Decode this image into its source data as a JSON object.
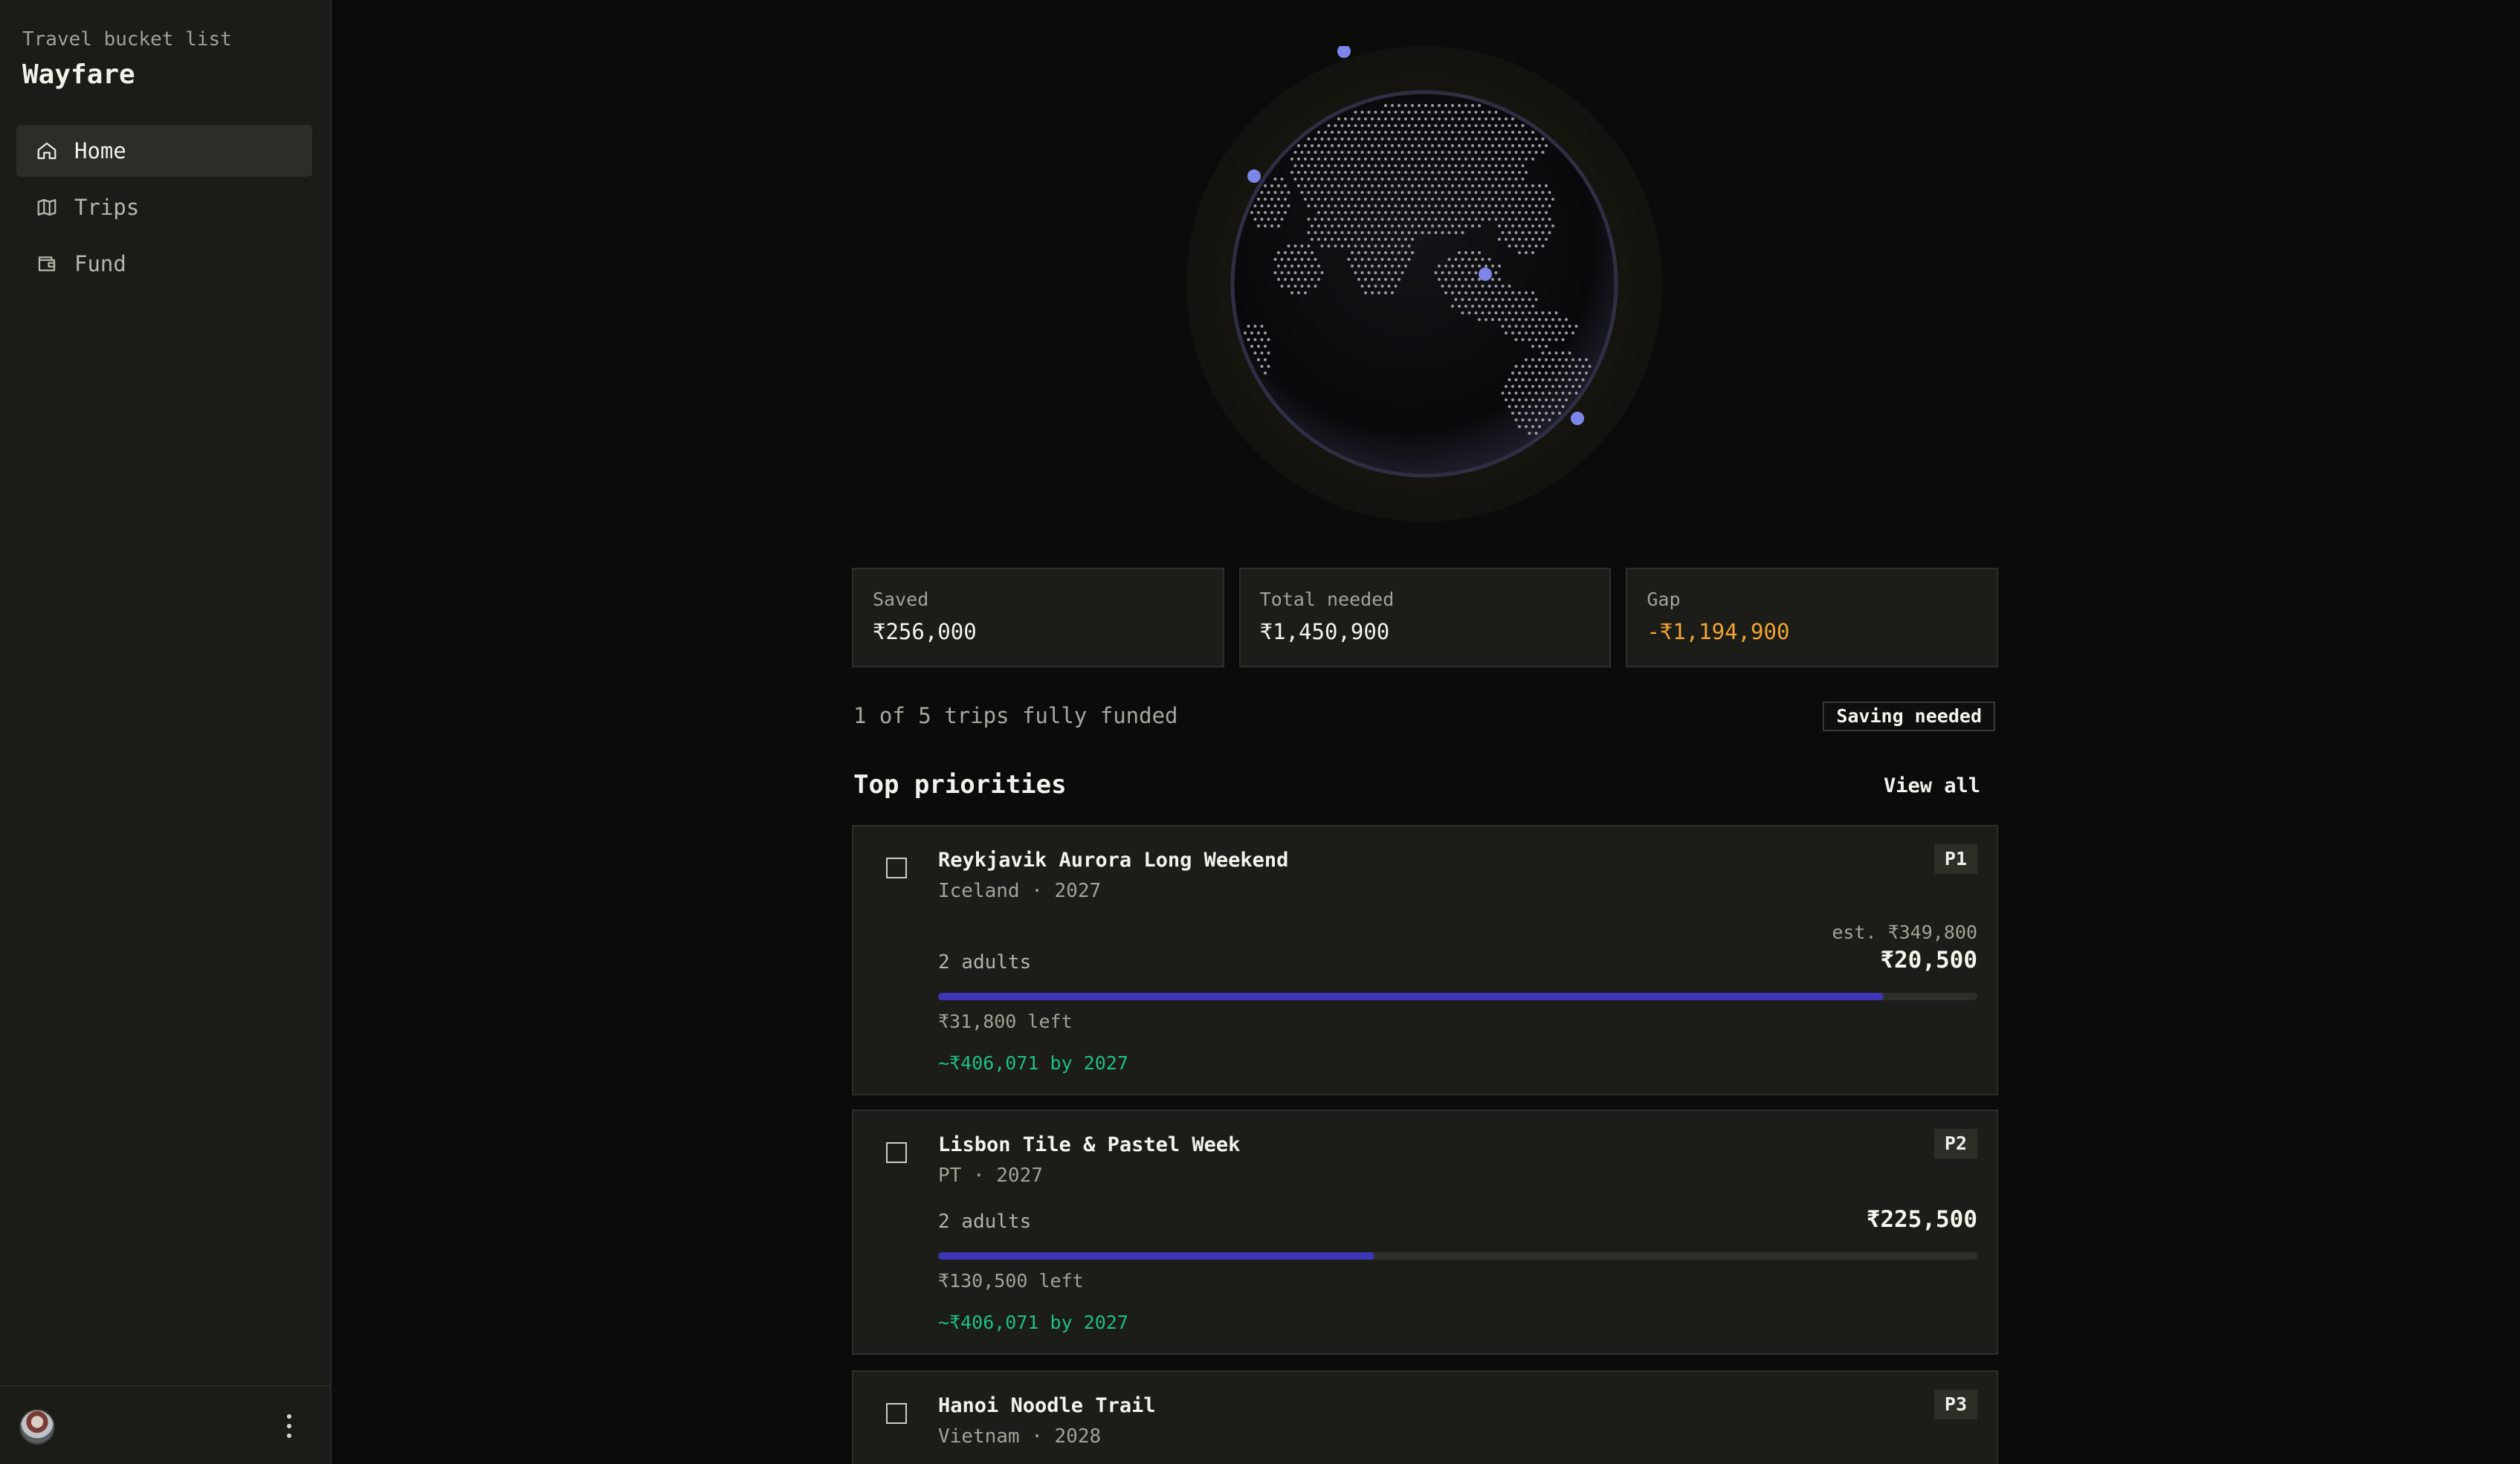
{
  "app": {
    "subtitle": "Travel bucket list",
    "title": "Wayfare"
  },
  "sidebar": {
    "items": [
      {
        "label": "Home",
        "icon": "home-icon",
        "active": true
      },
      {
        "label": "Trips",
        "icon": "map-icon",
        "active": false
      },
      {
        "label": "Fund",
        "icon": "wallet-icon",
        "active": false
      }
    ]
  },
  "stats": {
    "saved": {
      "label": "Saved",
      "value": "₹256,000"
    },
    "total": {
      "label": "Total needed",
      "value": "₹1,450,900"
    },
    "gap": {
      "label": "Gap",
      "value": "-₹1,194,900"
    }
  },
  "summary": {
    "funded_text": "1 of 5 trips fully funded",
    "status_badge": "Saving needed"
  },
  "priorities": {
    "title": "Top priorities",
    "view_all": "View all",
    "trips": [
      {
        "title": "Reykjavik Aurora Long Weekend",
        "subtitle": "Iceland · 2027",
        "priority": "P1",
        "estimate": "est. ₹349,800",
        "travelers": "2 adults",
        "amount": "₹20,500",
        "progress": 0.91,
        "left": "₹31,800 left",
        "projection": "~₹406,071 by 2027"
      },
      {
        "title": "Lisbon Tile & Pastel Week",
        "subtitle": "PT · 2027",
        "priority": "P2",
        "travelers": "2 adults",
        "amount": "₹225,500",
        "progress": 0.42,
        "left": "₹130,500 left",
        "projection": "~₹406,071 by 2027"
      },
      {
        "title": "Hanoi Noodle Trail",
        "subtitle": "Vietnam · 2028",
        "priority": "P3"
      }
    ]
  },
  "colors": {
    "accent": "#3d37b7",
    "marker": "#7b86e8",
    "warning": "#f0a531",
    "positive": "#1fbf85"
  }
}
